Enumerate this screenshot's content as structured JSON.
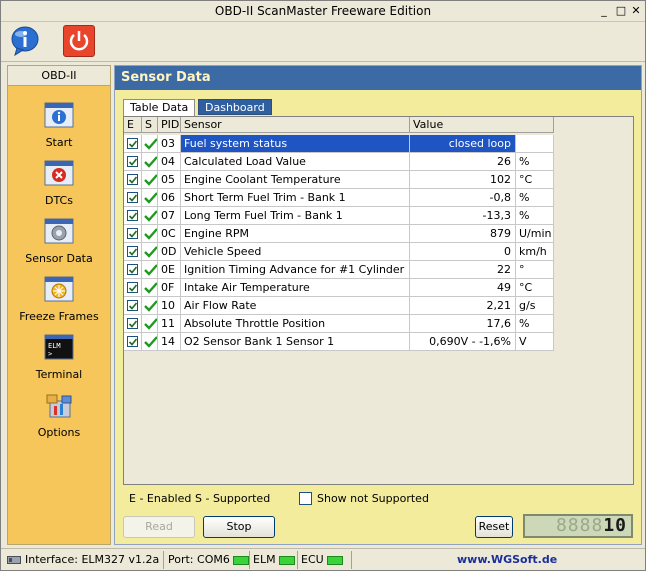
{
  "window": {
    "title": "OBD-II ScanMaster Freeware Edition",
    "min_glyph": "_",
    "max_glyph": "□",
    "close_glyph": "✕"
  },
  "toolbar": {
    "info_icon": "info-icon",
    "power_icon": "power-icon"
  },
  "sidebar": {
    "header": "OBD-II",
    "items": [
      {
        "label": "Start",
        "icon": "start-icon"
      },
      {
        "label": "DTCs",
        "icon": "dtc-icon"
      },
      {
        "label": "Sensor Data",
        "icon": "sensor-data-icon"
      },
      {
        "label": "Freeze Frames",
        "icon": "freeze-frames-icon"
      },
      {
        "label": "Terminal",
        "icon": "terminal-icon"
      },
      {
        "label": "Options",
        "icon": "options-icon"
      }
    ],
    "terminal_icon_text": "ELM\n>"
  },
  "main": {
    "title": "Sensor Data",
    "tabs": [
      "Table Data",
      "Dashboard"
    ],
    "table": {
      "headers": [
        "E",
        "S",
        "PID",
        "Sensor",
        "Value"
      ],
      "rows": [
        {
          "pid": "03",
          "sensor": "Fuel system status",
          "value": "closed loop",
          "unit": "",
          "selected": true
        },
        {
          "pid": "04",
          "sensor": "Calculated Load Value",
          "value": "26",
          "unit": "%"
        },
        {
          "pid": "05",
          "sensor": "Engine Coolant Temperature",
          "value": "102",
          "unit": "°C"
        },
        {
          "pid": "06",
          "sensor": "Short Term Fuel Trim - Bank 1",
          "value": "-0,8",
          "unit": "%"
        },
        {
          "pid": "07",
          "sensor": "Long Term Fuel Trim - Bank 1",
          "value": "-13,3",
          "unit": "%"
        },
        {
          "pid": "0C",
          "sensor": "Engine RPM",
          "value": "879",
          "unit": "U/min"
        },
        {
          "pid": "0D",
          "sensor": "Vehicle Speed",
          "value": "0",
          "unit": "km/h"
        },
        {
          "pid": "0E",
          "sensor": "Ignition Timing Advance for #1 Cylinder",
          "value": "22",
          "unit": "°"
        },
        {
          "pid": "0F",
          "sensor": "Intake Air Temperature",
          "value": "49",
          "unit": "°C"
        },
        {
          "pid": "10",
          "sensor": "Air Flow Rate",
          "value": "2,21",
          "unit": "g/s"
        },
        {
          "pid": "11",
          "sensor": "Absolute Throttle Position",
          "value": "17,6",
          "unit": "%"
        },
        {
          "pid": "14",
          "sensor": "O2 Sensor Bank 1 Sensor 1",
          "value": "0,690V - -1,6%",
          "unit": "V"
        }
      ]
    },
    "legend": {
      "enabled": "E - Enabled",
      "supported": "S - Supported",
      "show_not_supported": "Show not Supported"
    },
    "buttons": {
      "read": "Read",
      "stop": "Stop",
      "reset": "Reset"
    },
    "lcd": {
      "ghost": "8888",
      "value": "10"
    }
  },
  "status": {
    "interface": "Interface: ELM327 v1.2a",
    "port": "Port: COM6",
    "elm": "ELM",
    "ecu": "ECU",
    "website": "www.WGSoft.de",
    "led_color": "#3ad43a"
  }
}
